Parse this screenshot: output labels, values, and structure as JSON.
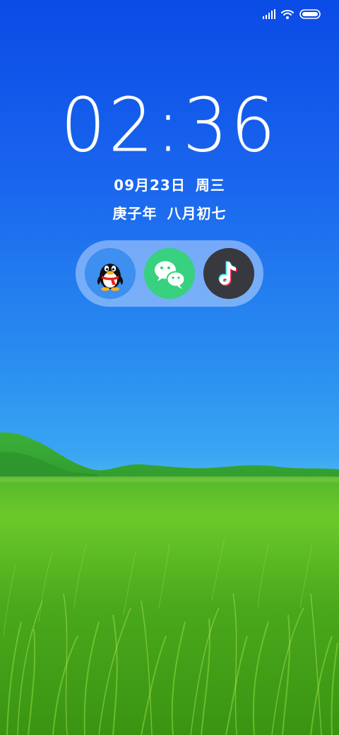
{
  "status_bar": {
    "signal_icon": "signal-bars-icon",
    "wifi_icon": "wifi-icon",
    "battery_icon": "battery-icon"
  },
  "lockscreen": {
    "time": "02:36",
    "date": "09月23日",
    "weekday": "周三",
    "lunar_year": "庚子年",
    "lunar_date": "八月初七"
  },
  "dock": {
    "apps": [
      {
        "icon": "qq-penguin-icon",
        "color": "#3d8ff0"
      },
      {
        "icon": "wechat-icon",
        "color": "#37d17f"
      },
      {
        "icon": "tiktok-icon",
        "color": "#38393e"
      }
    ]
  }
}
